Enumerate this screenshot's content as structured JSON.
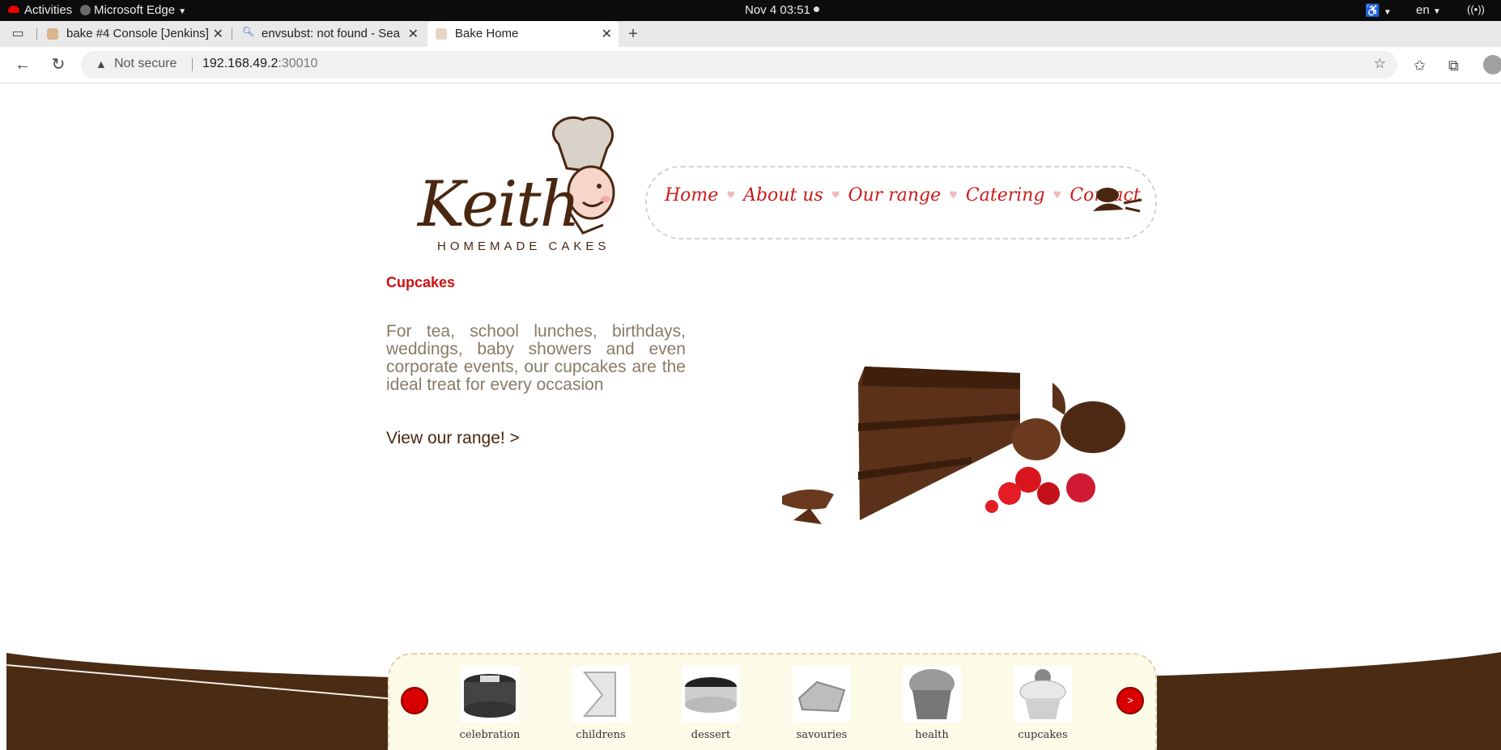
{
  "system_bar": {
    "activities": "Activities",
    "app_name": "Microsoft Edge",
    "datetime": "Nov 4  03:51",
    "lang": "en"
  },
  "tabs": [
    {
      "label": "bake #4 Console [Jenkins]",
      "favicon": "jenkins-icon"
    },
    {
      "label": "envsubst: not found - Sear",
      "favicon": "search-icon"
    },
    {
      "label": "Bake Home",
      "favicon": "bake-icon",
      "active": true
    }
  ],
  "address_bar": {
    "security_label": "Not secure",
    "host": "192.168.49.2",
    "port": ":30010"
  },
  "site": {
    "logo_text": "Keith",
    "logo_subtitle": "HOMEMADE CAKES",
    "nav": [
      "Home",
      "About us",
      "Our range",
      "Catering",
      "Contact"
    ],
    "heading": "Cupcakes",
    "description": "For tea, school lunches, birthdays, weddings, baby showers and even corporate events, our cupcakes are the ideal treat for every occasion",
    "cta": "View our range!   >",
    "carousel_next": ">",
    "carousel": [
      "celebration",
      "childrens",
      "dessert",
      "savouries",
      "health",
      "cupcakes"
    ]
  },
  "colors": {
    "brand_red": "#cc1111",
    "brand_brown": "#4a2710",
    "text_taupe": "#8a7a66"
  }
}
